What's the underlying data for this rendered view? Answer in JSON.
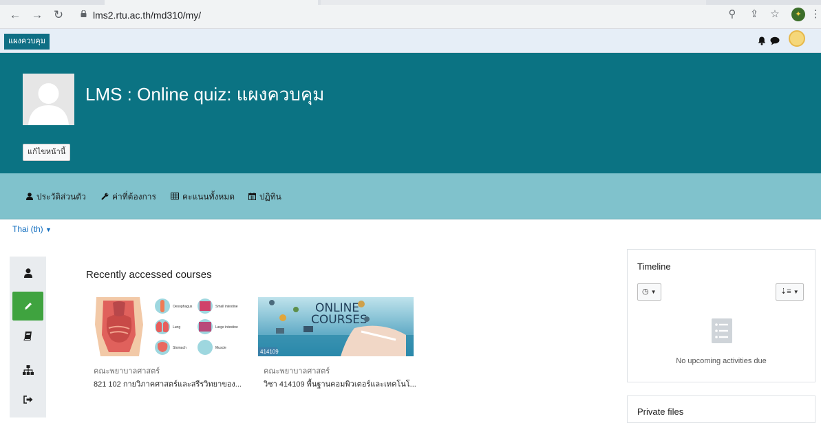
{
  "browser": {
    "url": "lms2.rtu.ac.th/md310/my/",
    "icons": [
      "back-arrow-icon",
      "forward-arrow-icon",
      "reload-icon",
      "lock-icon",
      "zoom-icon",
      "share-icon",
      "star-icon",
      "extension-avatar-icon",
      "kebab-menu-icon"
    ]
  },
  "navbar": {
    "dashboard_label": "แผงควบคุม",
    "icons": [
      "bell-icon",
      "chat-icon",
      "user-avatar"
    ]
  },
  "header": {
    "title": "LMS : Online quiz: แผงควบคุม",
    "edit_button": "แก้ไขหน้านี้"
  },
  "menu": {
    "items": [
      {
        "label": "ประวัติส่วนตัว",
        "icon": "user-icon"
      },
      {
        "label": "ค่าที่ต้องการ",
        "icon": "wrench-icon"
      },
      {
        "label": "คะแนนทั้งหมด",
        "icon": "table-icon"
      },
      {
        "label": "ปฏิทิน",
        "icon": "calendar-icon"
      }
    ]
  },
  "language": "Thai (th)",
  "rail": {
    "items": [
      "user-icon",
      "pencil-icon",
      "book-icon",
      "sitemap-icon",
      "sign-out-icon"
    ]
  },
  "recent": {
    "title": "Recently accessed courses",
    "courses": [
      {
        "category": "คณะพยาบาลศาสตร์",
        "name": "821 102 กายวิภาคศาสตร์และสรีรวิทยาของ..."
      },
      {
        "category": "คณะพยาบาลศาสตร์",
        "name": "วิชา 414109 พื้นฐานคอมพิวเตอร์และเทคโนโ...",
        "badge": "414109",
        "image_text_1": "ONLINE",
        "image_text_2": "COURSES"
      }
    ],
    "anatomy_labels": [
      "Oesophagus",
      "Small intestine",
      "Lung",
      "Large intestine",
      "Stomach",
      "Muscle"
    ]
  },
  "timeline": {
    "title": "Timeline",
    "empty_text": "No upcoming activities due"
  },
  "private_files": {
    "title": "Private files"
  },
  "colors": {
    "header_bg": "#0b7383",
    "menu_bg": "#80c2cc",
    "active_green": "#3fa33f",
    "nav_pill": "#0f6f85"
  }
}
